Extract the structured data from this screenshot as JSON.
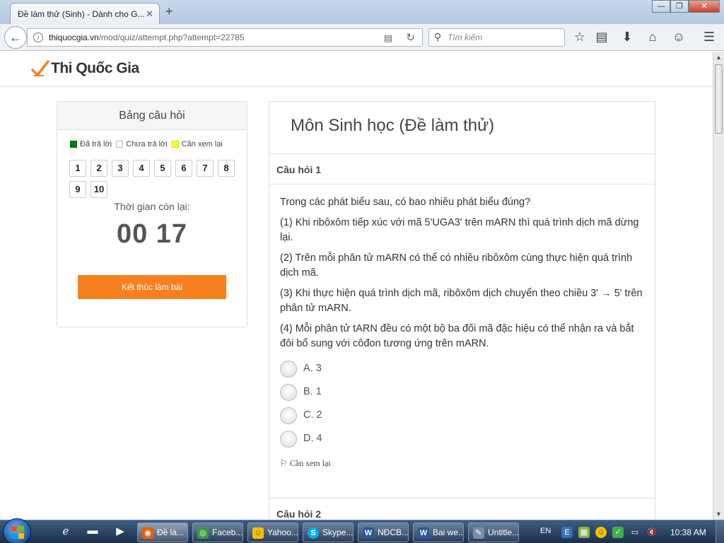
{
  "browser": {
    "tab_title": "Đề làm thử (Sinh) - Dành cho G...",
    "tab_close": "✕",
    "new_tab": "+",
    "url_domain": "thiquocgia.vn",
    "url_path": "/mod/quiz/attempt.php?attempt=22785",
    "search_placeholder": "Tìm kiếm",
    "window_buttons": {
      "minimize": "—",
      "maximize": "❐",
      "close": "✕"
    }
  },
  "site": {
    "logo_text": "Thi Quốc Gia"
  },
  "question_panel": {
    "title": "Bảng câu hỏi",
    "legend": [
      {
        "label": "Đã trả lời",
        "color": "#008000"
      },
      {
        "label": "Chưa trả lời",
        "color": "#ffffff"
      },
      {
        "label": "Cần xem lại",
        "color": "#ffff33"
      }
    ],
    "numbers": [
      "1",
      "2",
      "3",
      "4",
      "5",
      "6",
      "7",
      "8",
      "9",
      "10"
    ],
    "time_label": "Thời gian còn lại:",
    "time_value": "00 17",
    "finish_button": "Kết thúc làm bài",
    "accent_color": "#f7801e"
  },
  "quiz": {
    "title": "Môn Sinh học (Đề làm thử)",
    "question1": {
      "header": "Câu hỏi 1",
      "intro": "Trong các phát biểu sau, có bao nhiêu phát biểu đúng?",
      "statements": [
        "(1) Khi ribôxôm tiếp xúc với mã 5'UGA3' trên mARN thì quá trình dịch mã dừng lại.",
        "(2) Trên mỗi phân tử mARN có thể có nhiều ribôxôm cùng thực hiện quá trình dịch mã.",
        "(3) Khi thực hiện quá trình dịch mã, ribôxôm dịch chuyển theo chiều 3' → 5' trên phân tử mARN.",
        "(4) Mỗi phân tử tARN đều có một bộ ba đối mã đặc hiệu có thể nhận ra và bắt đôi bổ sung với côđon tương ứng trên mARN."
      ],
      "answers": [
        "A. 3",
        "B. 1",
        "C. 2",
        "D. 4"
      ],
      "flag_label": "Cần xem lại"
    },
    "question2": {
      "header": "Câu hỏi 2"
    }
  },
  "taskbar": {
    "tasks": [
      {
        "label": "Đề là...",
        "icon_color": "#e66000"
      },
      {
        "label": "Faceb...",
        "icon_color": "#3b9a3b"
      },
      {
        "label": "Yahoo...",
        "icon_color": "#f2c200"
      },
      {
        "label": "Skype...",
        "icon_color": "#00aff0"
      },
      {
        "label": "NĐCB....",
        "icon_color": "#2b579a"
      },
      {
        "label": "Bai we...",
        "icon_color": "#2b579a"
      },
      {
        "label": "Untitle...",
        "icon_color": "#7a8fa6"
      }
    ],
    "language": "EN",
    "clock": "10:38 AM"
  }
}
